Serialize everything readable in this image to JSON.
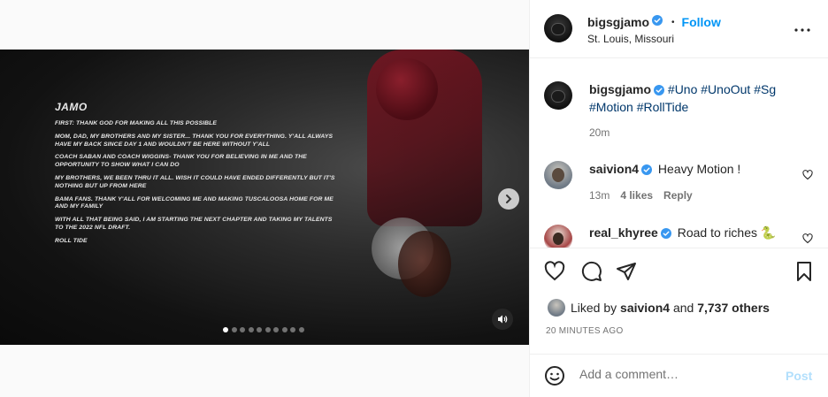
{
  "post": {
    "author": "bigsgjamo",
    "follow_label": "Follow",
    "location": "St. Louis, Missouri",
    "separator": "•"
  },
  "media": {
    "title": "JAMO",
    "paragraphs": [
      "FIRST: THANK GOD FOR MAKING ALL THIS POSSIBLE",
      "MOM, DAD, MY BROTHERS AND MY SISTER... THANK YOU FOR EVERYTHING. Y'ALL ALWAYS HAVE MY BACK SINCE DAY 1 AND WOULDN'T BE HERE WITHOUT Y'ALL",
      "COACH SABAN AND COACH WIGGINS- THANK YOU FOR BELIEVING IN ME AND THE OPPORTUNITY TO SHOW WHAT I CAN DO",
      "MY BROTHERS, WE BEEN THRU IT ALL. WISH IT COULD HAVE ENDED DIFFERENTLY BUT IT'S NOTHING BUT UP FROM HERE",
      "BAMA FANS. THANK Y'ALL FOR WELCOMING ME AND MAKING TUSCALOOSA HOME FOR ME AND MY FAMILY",
      "WITH ALL THAT BEING SAID, I AM STARTING THE NEXT CHAPTER AND TAKING MY TALENTS TO THE 2022 NFL DRAFT.",
      "ROLL TIDE"
    ],
    "carousel_count": 10,
    "carousel_active": 0
  },
  "caption": {
    "author": "bigsgjamo",
    "tags": [
      "#Uno",
      "#UnoOut",
      "#Sg",
      "#Motion",
      "#RollTide"
    ],
    "time": "20m"
  },
  "comments": [
    {
      "author": "saivion4",
      "text": "Heavy Motion !",
      "time": "13m",
      "likes": "4 likes",
      "reply": "Reply"
    },
    {
      "author": "real_khyree",
      "text": "Road to riches 🐍"
    }
  ],
  "likes": {
    "prefix": "Liked by",
    "user": "saivion4",
    "conj": "and",
    "others": "7,737 others"
  },
  "timestamp": "20 MINUTES AGO",
  "comment_box": {
    "placeholder": "Add a comment…",
    "post_label": "Post"
  },
  "colors": {
    "accent": "#0095f6",
    "hashtag": "#00376b",
    "verified": "#3897f0",
    "post_disabled": "#b2dffc"
  },
  "icons": {
    "more": "more-horizontal-icon",
    "like": "heart-icon",
    "comment": "comment-icon",
    "share": "send-icon",
    "save": "bookmark-icon",
    "emoji": "emoji-icon",
    "next": "chevron-right-icon",
    "sound": "speaker-icon",
    "verified": "verified-badge-icon"
  }
}
